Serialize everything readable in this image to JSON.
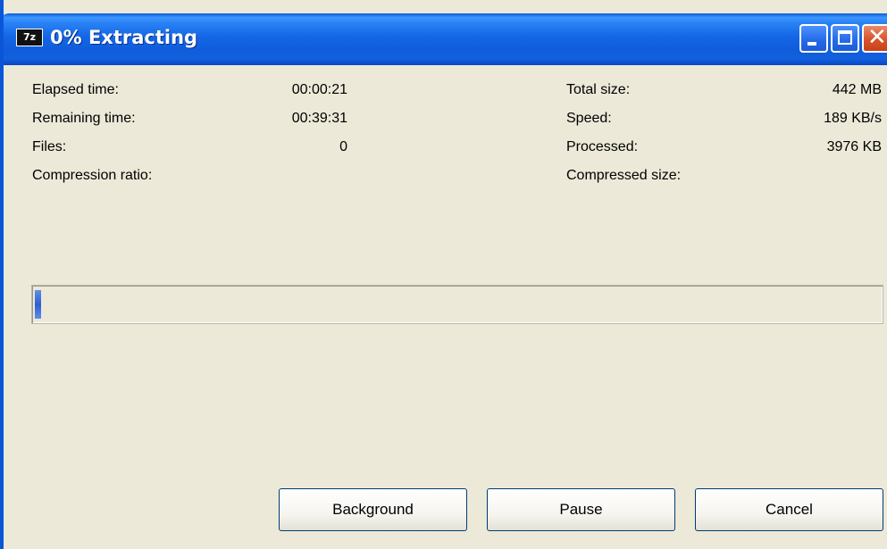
{
  "window": {
    "title": "0% Extracting",
    "icon_text": "7z"
  },
  "stats": {
    "left": [
      {
        "label": "Elapsed time:",
        "value": "00:00:21"
      },
      {
        "label": "Remaining time:",
        "value": "00:39:31"
      },
      {
        "label": "Files:",
        "value": "0"
      },
      {
        "label": "Compression ratio:",
        "value": ""
      }
    ],
    "right": [
      {
        "label": "Total size:",
        "value": "442 MB"
      },
      {
        "label": "Speed:",
        "value": "189 KB/s"
      },
      {
        "label": "Processed:",
        "value": "3976 KB"
      },
      {
        "label": "Compressed size:",
        "value": ""
      }
    ]
  },
  "progress": {
    "fraction": 0.007
  },
  "buttons": {
    "background": "Background",
    "pause": "Pause",
    "cancel": "Cancel"
  },
  "colors": {
    "titlebar": "#1466e6",
    "dialog": "#ece9d8",
    "progress_fill": "#2b5fd0",
    "close_button": "#d7542a"
  },
  "icons": {
    "app": "7zip-icon",
    "minimize": "minimize-icon",
    "maximize": "maximize-icon",
    "close": "close-icon"
  }
}
